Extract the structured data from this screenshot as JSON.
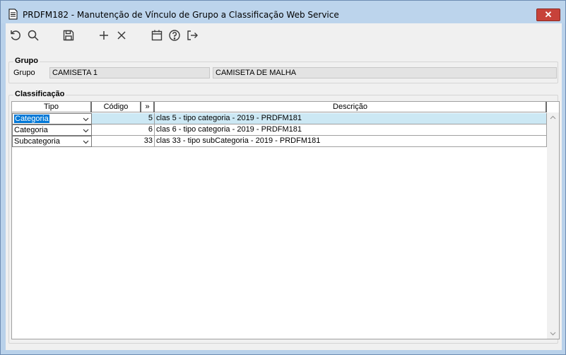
{
  "window": {
    "title": "PRDFM182 - Manutenção de Vínculo de Grupo a Classificação Web Service",
    "close_label": "✕"
  },
  "toolbar": {
    "buttons": [
      {
        "name": "undo-icon"
      },
      {
        "name": "search-icon"
      },
      {
        "name": "save-icon"
      },
      {
        "name": "add-icon"
      },
      {
        "name": "delete-icon"
      },
      {
        "name": "calendar-icon"
      },
      {
        "name": "help-icon"
      },
      {
        "name": "exit-icon"
      }
    ]
  },
  "grupo": {
    "section_title": "Grupo",
    "label": "Grupo",
    "code_value": "CAMISETA 1",
    "description_value": "CAMISETA DE MALHA"
  },
  "classificacao": {
    "section_title": "Classificação",
    "columns": {
      "tipo": "Tipo",
      "codigo": "Código",
      "lookup": "»",
      "descricao": "Descrição"
    },
    "rows": [
      {
        "tipo": "Categoria",
        "codigo": "5",
        "descricao": "clas 5 - tipo categoria - 2019 - PRDFM181",
        "selected": true
      },
      {
        "tipo": "Categoria",
        "codigo": "6",
        "descricao": "clas 6 - tipo categoria - 2019 - PRDFM181",
        "selected": false
      },
      {
        "tipo": "Subcategoria",
        "codigo": "33",
        "descricao": "clas 33 - tipo subCategoria - 2019 - PRDFM181",
        "selected": false
      }
    ]
  },
  "colors": {
    "title_bar": "#bcd4ec",
    "close_button": "#c7423a",
    "selected_row": "#cce8f4",
    "selected_text_bg": "#0078d7"
  }
}
